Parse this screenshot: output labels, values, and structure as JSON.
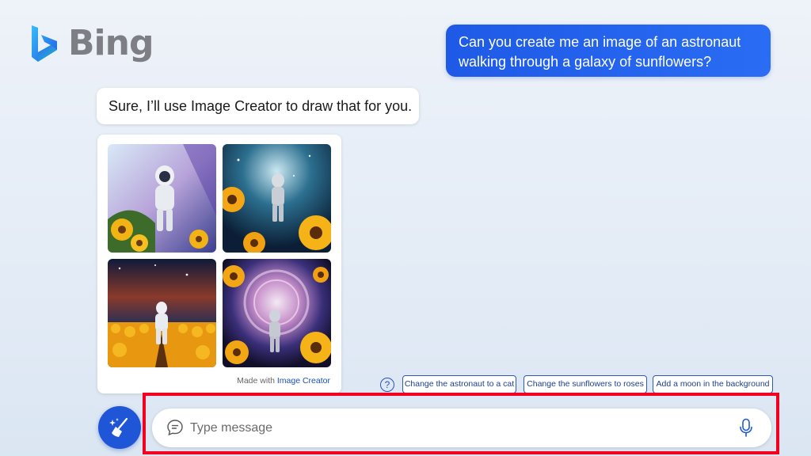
{
  "brand": {
    "name": "Bing",
    "logo_icon": "bing-b-logo"
  },
  "conversation": {
    "user_message": "Can you create me an image of an astronaut walking through a galaxy of sunflowers?",
    "bot_message": "Sure, I’ll use Image Creator to draw that for you.",
    "image_card": {
      "images": [
        "astronaut-sunflowers-1",
        "astronaut-sunflowers-2",
        "astronaut-sunflowers-3",
        "astronaut-sunflowers-4"
      ],
      "made_with_prefix": "Made with ",
      "made_with_link": "Image Creator"
    }
  },
  "suggestions": {
    "help_icon": "?",
    "chips": [
      "Change the astronaut to a cat",
      "Change the sunflowers to roses",
      "Add a moon in the background"
    ]
  },
  "composer": {
    "new_topic_icon": "broom-sparkle-icon",
    "placeholder": "Type message",
    "value": "",
    "chat_icon": "chat-bubble-icon",
    "mic_icon": "microphone-icon"
  },
  "colors": {
    "accent": "#1f56d8",
    "highlight": "#f2001f",
    "user_bubble": "#1e5ae6"
  }
}
